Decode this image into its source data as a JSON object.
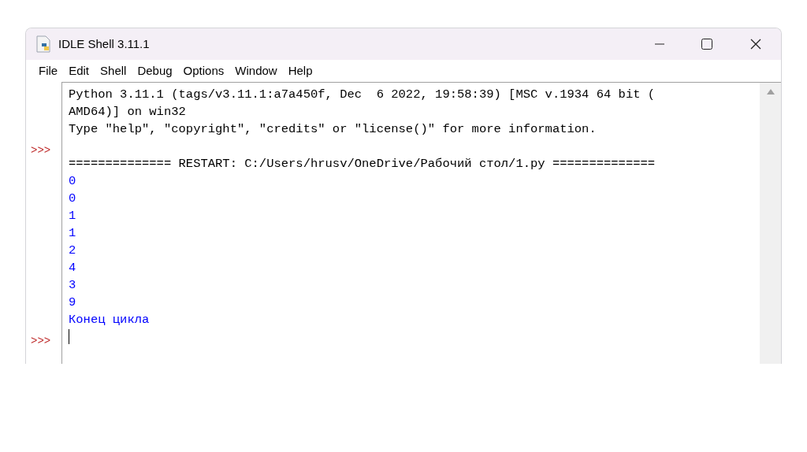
{
  "window": {
    "title": "IDLE Shell 3.11.1"
  },
  "menu": [
    "File",
    "Edit",
    "Shell",
    "Debug",
    "Options",
    "Window",
    "Help"
  ],
  "shell": {
    "lines": [
      {
        "kind": "banner",
        "text": "Python 3.11.1 (tags/v3.11.1:a7a450f, Dec  6 2022, 19:58:39) [MSC v.1934 64 bit ("
      },
      {
        "kind": "banner",
        "text": "AMD64)] on win32"
      },
      {
        "kind": "banner",
        "text": "Type \"help\", \"copyright\", \"credits\" or \"license()\" for more information."
      },
      {
        "prompt": ">>>"
      },
      {
        "kind": "banner",
        "text": "============== RESTART: C:/Users/hrusv/OneDrive/Рабочий стол/1.py =============="
      },
      {
        "kind": "stdout",
        "text": "0"
      },
      {
        "kind": "stdout",
        "text": "0"
      },
      {
        "kind": "stdout",
        "text": "1"
      },
      {
        "kind": "stdout",
        "text": "1"
      },
      {
        "kind": "stdout",
        "text": "2"
      },
      {
        "kind": "stdout",
        "text": "4"
      },
      {
        "kind": "stdout",
        "text": "3"
      },
      {
        "kind": "stdout",
        "text": "9"
      },
      {
        "kind": "stdout",
        "text": "Конец цикла"
      },
      {
        "prompt": ">>>",
        "cursor": true
      }
    ]
  }
}
